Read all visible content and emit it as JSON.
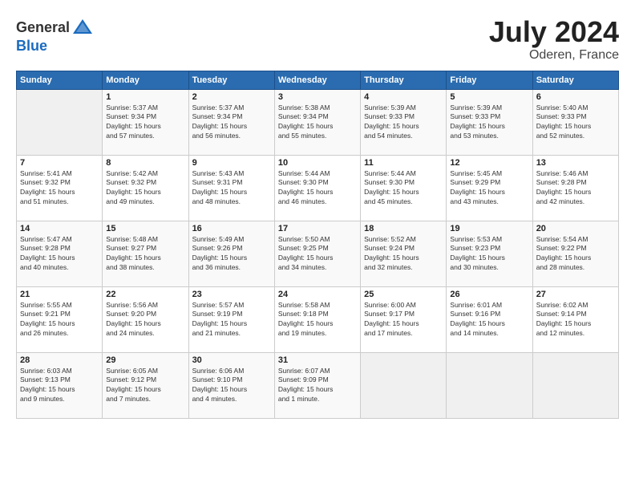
{
  "header": {
    "logo_general": "General",
    "logo_blue": "Blue",
    "month_year": "July 2024",
    "location": "Oderen, France"
  },
  "days_of_week": [
    "Sunday",
    "Monday",
    "Tuesday",
    "Wednesday",
    "Thursday",
    "Friday",
    "Saturday"
  ],
  "weeks": [
    [
      {
        "day": "",
        "info": ""
      },
      {
        "day": "1",
        "info": "Sunrise: 5:37 AM\nSunset: 9:34 PM\nDaylight: 15 hours\nand 57 minutes."
      },
      {
        "day": "2",
        "info": "Sunrise: 5:37 AM\nSunset: 9:34 PM\nDaylight: 15 hours\nand 56 minutes."
      },
      {
        "day": "3",
        "info": "Sunrise: 5:38 AM\nSunset: 9:34 PM\nDaylight: 15 hours\nand 55 minutes."
      },
      {
        "day": "4",
        "info": "Sunrise: 5:39 AM\nSunset: 9:33 PM\nDaylight: 15 hours\nand 54 minutes."
      },
      {
        "day": "5",
        "info": "Sunrise: 5:39 AM\nSunset: 9:33 PM\nDaylight: 15 hours\nand 53 minutes."
      },
      {
        "day": "6",
        "info": "Sunrise: 5:40 AM\nSunset: 9:33 PM\nDaylight: 15 hours\nand 52 minutes."
      }
    ],
    [
      {
        "day": "7",
        "info": "Sunrise: 5:41 AM\nSunset: 9:32 PM\nDaylight: 15 hours\nand 51 minutes."
      },
      {
        "day": "8",
        "info": "Sunrise: 5:42 AM\nSunset: 9:32 PM\nDaylight: 15 hours\nand 49 minutes."
      },
      {
        "day": "9",
        "info": "Sunrise: 5:43 AM\nSunset: 9:31 PM\nDaylight: 15 hours\nand 48 minutes."
      },
      {
        "day": "10",
        "info": "Sunrise: 5:44 AM\nSunset: 9:30 PM\nDaylight: 15 hours\nand 46 minutes."
      },
      {
        "day": "11",
        "info": "Sunrise: 5:44 AM\nSunset: 9:30 PM\nDaylight: 15 hours\nand 45 minutes."
      },
      {
        "day": "12",
        "info": "Sunrise: 5:45 AM\nSunset: 9:29 PM\nDaylight: 15 hours\nand 43 minutes."
      },
      {
        "day": "13",
        "info": "Sunrise: 5:46 AM\nSunset: 9:28 PM\nDaylight: 15 hours\nand 42 minutes."
      }
    ],
    [
      {
        "day": "14",
        "info": "Sunrise: 5:47 AM\nSunset: 9:28 PM\nDaylight: 15 hours\nand 40 minutes."
      },
      {
        "day": "15",
        "info": "Sunrise: 5:48 AM\nSunset: 9:27 PM\nDaylight: 15 hours\nand 38 minutes."
      },
      {
        "day": "16",
        "info": "Sunrise: 5:49 AM\nSunset: 9:26 PM\nDaylight: 15 hours\nand 36 minutes."
      },
      {
        "day": "17",
        "info": "Sunrise: 5:50 AM\nSunset: 9:25 PM\nDaylight: 15 hours\nand 34 minutes."
      },
      {
        "day": "18",
        "info": "Sunrise: 5:52 AM\nSunset: 9:24 PM\nDaylight: 15 hours\nand 32 minutes."
      },
      {
        "day": "19",
        "info": "Sunrise: 5:53 AM\nSunset: 9:23 PM\nDaylight: 15 hours\nand 30 minutes."
      },
      {
        "day": "20",
        "info": "Sunrise: 5:54 AM\nSunset: 9:22 PM\nDaylight: 15 hours\nand 28 minutes."
      }
    ],
    [
      {
        "day": "21",
        "info": "Sunrise: 5:55 AM\nSunset: 9:21 PM\nDaylight: 15 hours\nand 26 minutes."
      },
      {
        "day": "22",
        "info": "Sunrise: 5:56 AM\nSunset: 9:20 PM\nDaylight: 15 hours\nand 24 minutes."
      },
      {
        "day": "23",
        "info": "Sunrise: 5:57 AM\nSunset: 9:19 PM\nDaylight: 15 hours\nand 21 minutes."
      },
      {
        "day": "24",
        "info": "Sunrise: 5:58 AM\nSunset: 9:18 PM\nDaylight: 15 hours\nand 19 minutes."
      },
      {
        "day": "25",
        "info": "Sunrise: 6:00 AM\nSunset: 9:17 PM\nDaylight: 15 hours\nand 17 minutes."
      },
      {
        "day": "26",
        "info": "Sunrise: 6:01 AM\nSunset: 9:16 PM\nDaylight: 15 hours\nand 14 minutes."
      },
      {
        "day": "27",
        "info": "Sunrise: 6:02 AM\nSunset: 9:14 PM\nDaylight: 15 hours\nand 12 minutes."
      }
    ],
    [
      {
        "day": "28",
        "info": "Sunrise: 6:03 AM\nSunset: 9:13 PM\nDaylight: 15 hours\nand 9 minutes."
      },
      {
        "day": "29",
        "info": "Sunrise: 6:05 AM\nSunset: 9:12 PM\nDaylight: 15 hours\nand 7 minutes."
      },
      {
        "day": "30",
        "info": "Sunrise: 6:06 AM\nSunset: 9:10 PM\nDaylight: 15 hours\nand 4 minutes."
      },
      {
        "day": "31",
        "info": "Sunrise: 6:07 AM\nSunset: 9:09 PM\nDaylight: 15 hours\nand 1 minute."
      },
      {
        "day": "",
        "info": ""
      },
      {
        "day": "",
        "info": ""
      },
      {
        "day": "",
        "info": ""
      }
    ]
  ]
}
